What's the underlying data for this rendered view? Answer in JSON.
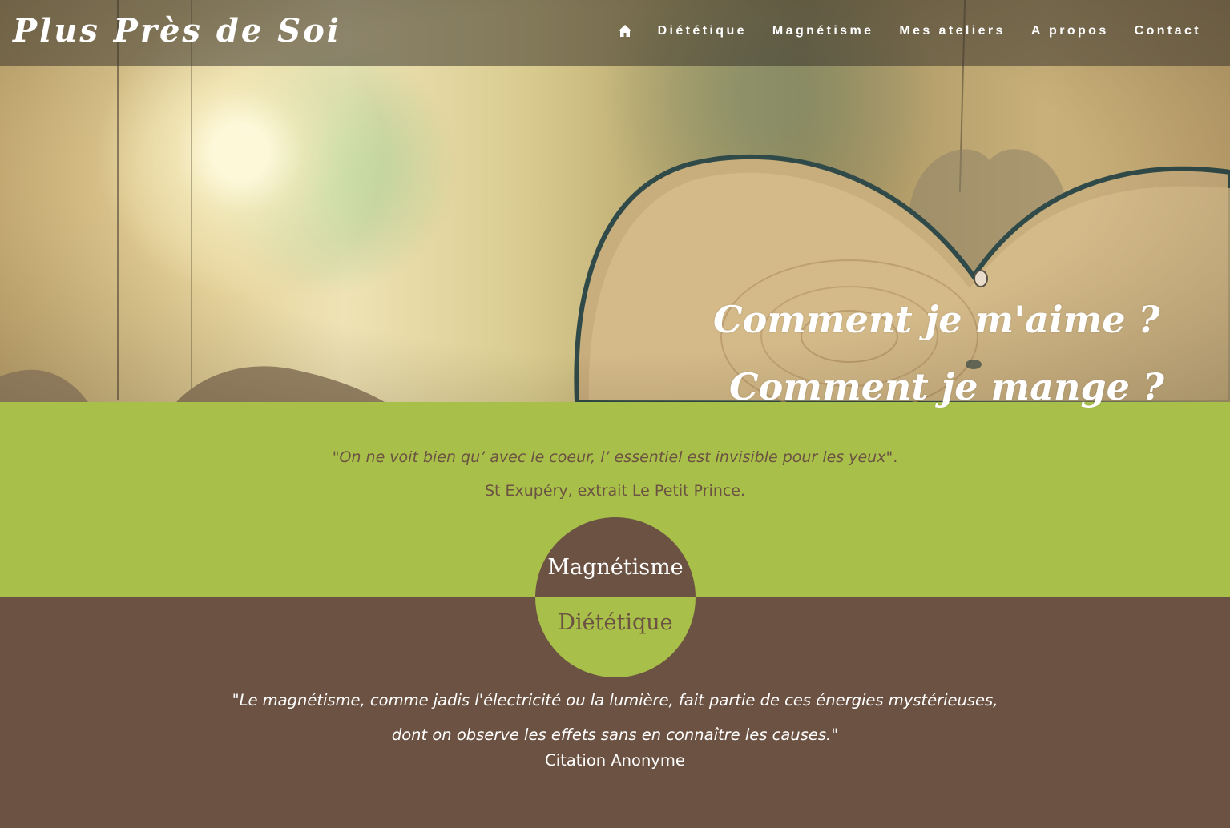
{
  "header": {
    "logo": "Plus Près de Soi",
    "nav": {
      "home_icon": "home-icon",
      "items": [
        "Diététique",
        "Magnétisme",
        "Mes ateliers",
        "A propos",
        "Contact"
      ]
    }
  },
  "hero": {
    "image": "wooden-hearts-hanging-photo",
    "tagline_1": "Comment je m'aime ?",
    "tagline_2": "Comment je mange ?"
  },
  "quote_section": {
    "quote_open": "\"",
    "quote_text": "On ne voit bien qu’ avec le coeur, l’ essentiel est invisible pour les yeux",
    "quote_close": "\".",
    "author": "St Exupéry, extrait Le Petit Prince."
  },
  "circle": {
    "top_label": "Magnétisme",
    "bottom_label": "Diététique"
  },
  "bottom_section": {
    "quote_open": "\"",
    "quote_line_1": "Le magnétisme, comme jadis l'électricité ou la lumière, fait partie de ces énergies mystérieuses,",
    "quote_line_2": "dont on observe les effets sans en connaître les causes.",
    "quote_close": "\"",
    "author": "Citation Anonyme"
  },
  "colors": {
    "green": "#a8c04a",
    "brown": "#6b5242",
    "white": "#ffffff"
  }
}
